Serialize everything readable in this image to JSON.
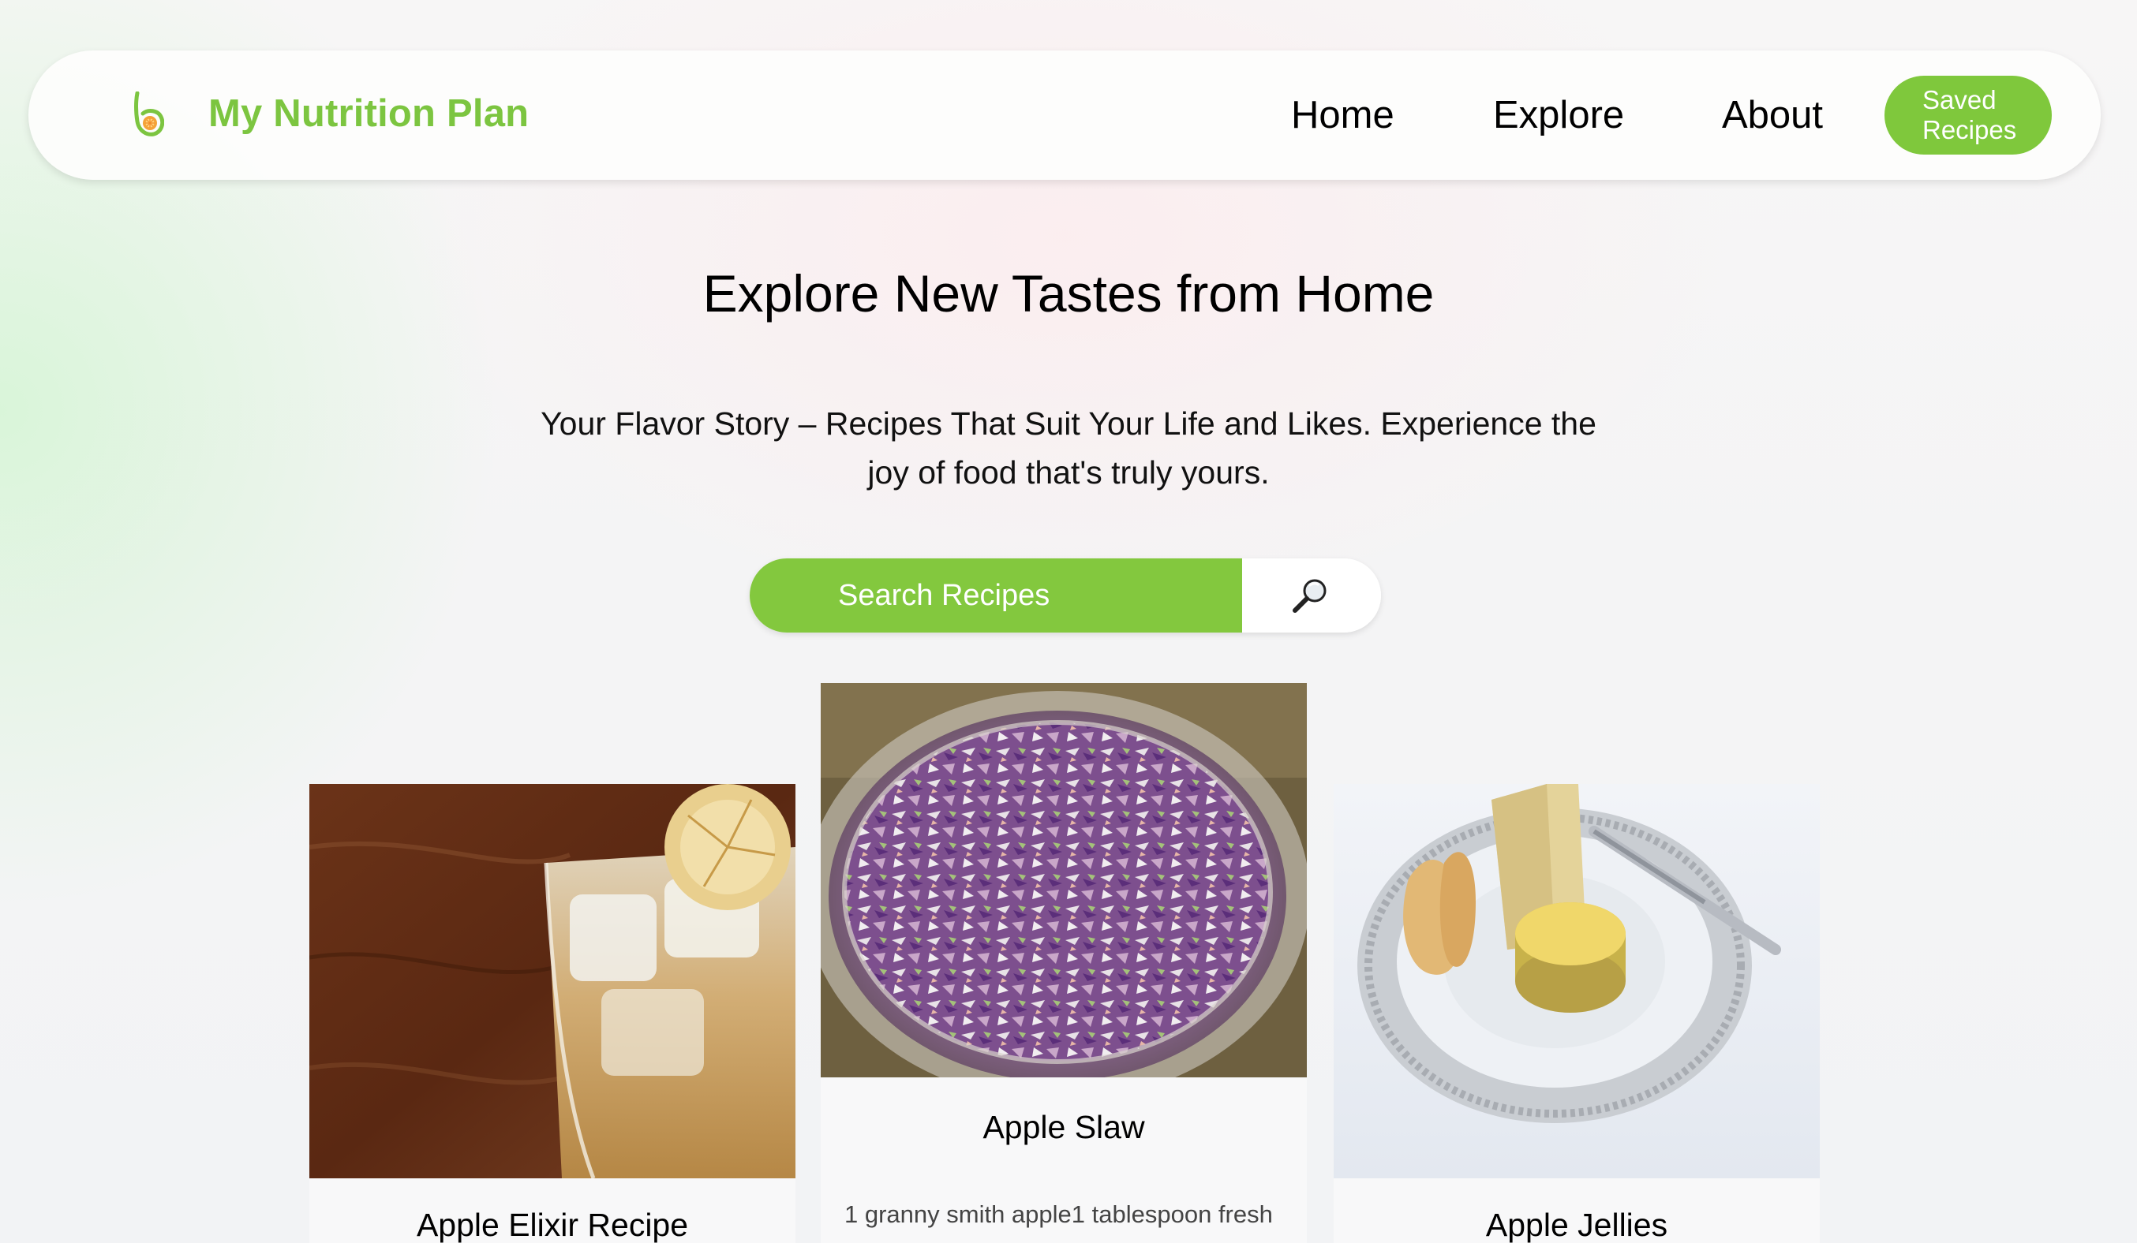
{
  "header": {
    "brand": "My Nutrition Plan",
    "logo_icon": "leaf-swirl-logo-icon",
    "nav": {
      "home": "Home",
      "explore": "Explore",
      "about": "About"
    },
    "saved_button": "Saved Recipes"
  },
  "hero": {
    "title": "Explore New Tastes from Home",
    "subtitle": "Your Flavor Story – Recipes That Suit Your Life and Likes. Experience the joy of food that's truly yours."
  },
  "search": {
    "placeholder": "Search Recipes",
    "button_icon": "magnifier-icon"
  },
  "recipes": [
    {
      "title": "Apple Elixir Recipe",
      "image": "apple-elixir-drink-image"
    },
    {
      "title": "Apple Slaw",
      "description": "1 granny smith apple1 tablespoon fresh",
      "image": "apple-slaw-salad-image"
    },
    {
      "title": "Apple Jellies",
      "image": "apple-jellies-plate-image"
    }
  ],
  "colors": {
    "accent_green": "#7fc83c",
    "brand_green": "#7cc540",
    "text": "#000000"
  }
}
